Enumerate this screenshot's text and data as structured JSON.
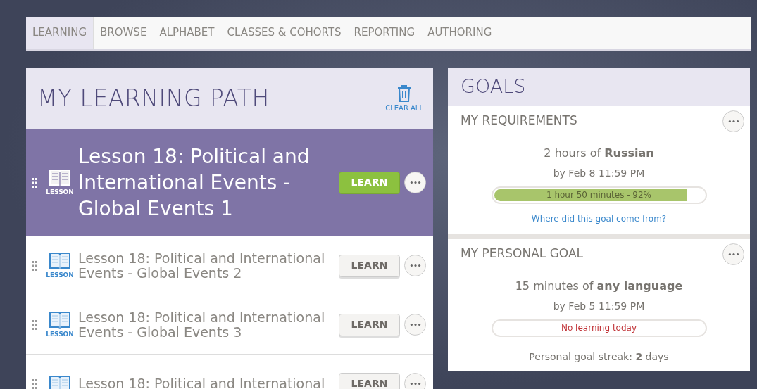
{
  "nav": [
    {
      "label": "LEARNING",
      "selected": true
    },
    {
      "label": "BROWSE",
      "selected": false
    },
    {
      "label": "ALPHABET",
      "selected": false
    },
    {
      "label": "CLASSES & COHORTS",
      "selected": false
    },
    {
      "label": "REPORTING",
      "selected": false
    },
    {
      "label": "AUTHORING",
      "selected": false
    }
  ],
  "learning_path": {
    "title": "MY LEARNING PATH",
    "clear_all": "CLEAR ALL",
    "items": [
      {
        "type_label": "LESSON",
        "title": "Lesson 18: Political and International Events - Global Events 1",
        "button": "LEARN",
        "selected": true
      },
      {
        "type_label": "LESSON",
        "title": "Lesson 18: Political and International Events - Global Events 2",
        "button": "LEARN",
        "selected": false
      },
      {
        "type_label": "LESSON",
        "title": "Lesson 18: Political and International Events - Global Events 3",
        "button": "LEARN",
        "selected": false
      },
      {
        "title": "Lesson 18: Political and International",
        "button": "LEARN",
        "selected": false
      }
    ]
  },
  "goals": {
    "title": "GOALS",
    "sections": [
      {
        "heading": "MY REQUIREMENTS",
        "goal": "2 hours of **Russian**",
        "deadline": "by Feb 8 11:59 PM",
        "progress_text": "1 hour 50 minutes - 92%",
        "level": 0.92,
        "link": "Where did this goal come from?"
      },
      {
        "heading": "MY PERSONAL GOAL",
        "goal": "15 minutes of **any language**",
        "deadline": "by Feb 5 11:59 PM",
        "progress_text": "No learning today",
        "level": 0,
        "streak": "Personal goal streak: **2** days"
      }
    ]
  }
}
